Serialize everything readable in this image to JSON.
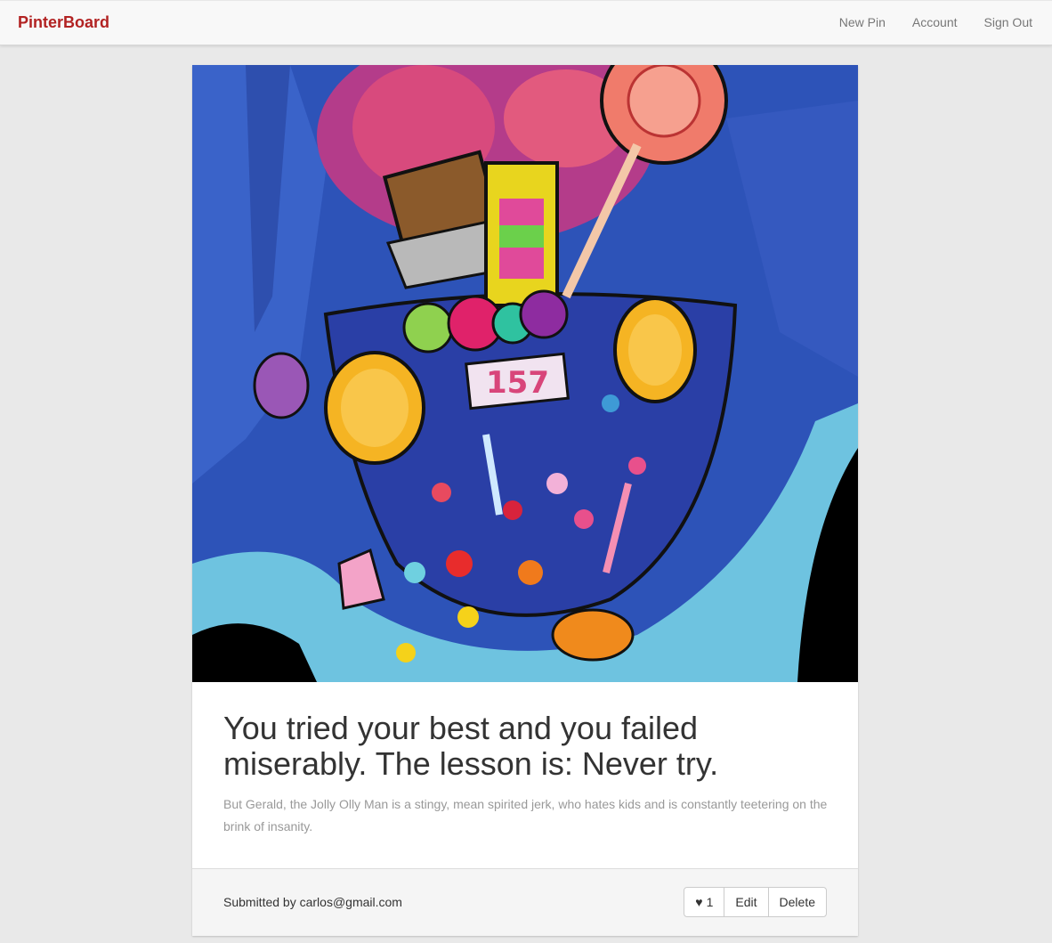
{
  "navbar": {
    "brand": "PinterBoard",
    "links": [
      "New Pin",
      "Account",
      "Sign Out"
    ],
    "brand_color": "#b22222"
  },
  "pin": {
    "image_alt": "Illustration of a candy-filled pocket",
    "image_label_text": "157",
    "title": "You tried your best and you failed miserably. The lesson is: Never try.",
    "description": "But Gerald, the Jolly Olly Man is a stingy, mean spirited jerk, who hates kids and is constantly teetering on the brink of insanity.",
    "submitted_by": "Submitted by carlos@gmail.com",
    "like_count": "1",
    "edit_label": "Edit",
    "delete_label": "Delete",
    "like_icon": "heart-icon"
  }
}
